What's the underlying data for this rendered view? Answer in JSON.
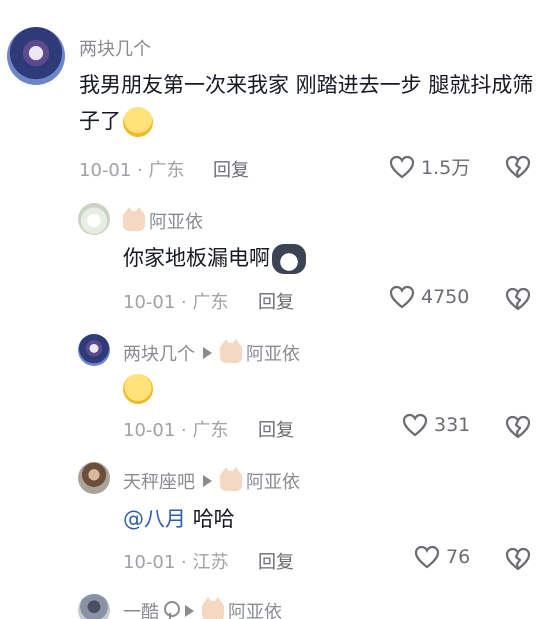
{
  "comments": [
    {
      "username": "两块几个",
      "text": "我男朋友第一次来我家 刚踏进去一步 腿就抖成筛子了",
      "emoji": "smiling-face-emoji",
      "date_location": "10-01 · 广东",
      "reply_label": "回复",
      "likes": "1.5万"
    }
  ],
  "replies": [
    {
      "username": "阿亚依",
      "user_badge": "cat-icon",
      "text": "你家地板漏电啊",
      "emoji": "husky-emoji",
      "date_location": "10-01 · 广东",
      "reply_label": "回复",
      "likes": "4750"
    },
    {
      "username": "两块几个",
      "reply_to": "阿亚依",
      "emoji": "thinking-face-emoji",
      "date_location": "10-01 · 广东",
      "reply_label": "回复",
      "likes": "331"
    },
    {
      "username": "天秤座吧",
      "reply_to": "阿亚依",
      "mention": "@八月",
      "text": "哈哈",
      "date_location": "10-01 · 江苏",
      "reply_label": "回复",
      "likes": "76"
    },
    {
      "username": "一酷",
      "reply_to": "阿亚依"
    }
  ],
  "colors": {
    "text": "#161823",
    "meta": "#a1a2a7",
    "mention": "#2f5ea8"
  }
}
